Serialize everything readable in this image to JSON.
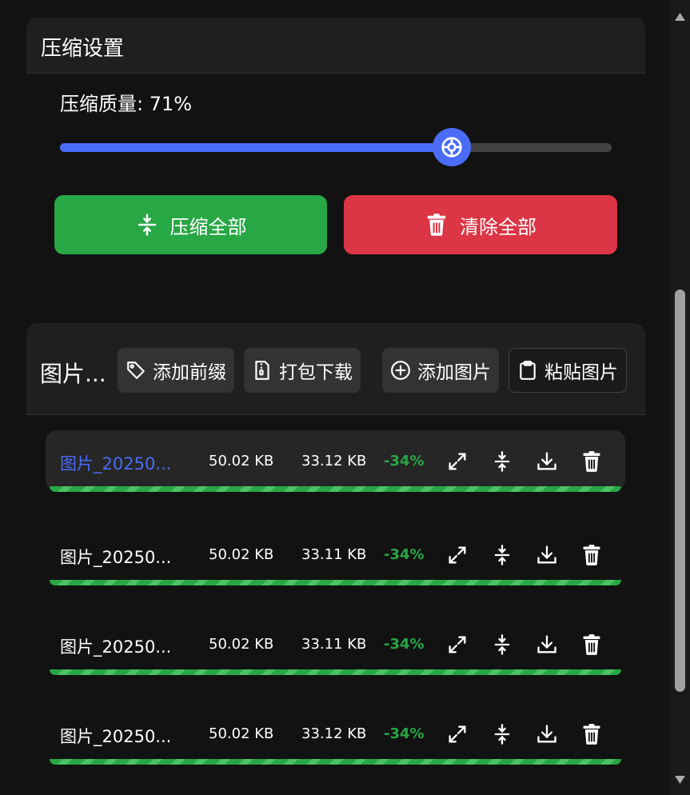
{
  "settings": {
    "title": "压缩设置",
    "quality_label": "压缩质量: 71%",
    "quality_value": 0.71,
    "accent_color": "#4a6cf7"
  },
  "actions": {
    "compress_all_label": "压缩全部",
    "clear_all_label": "清除全部",
    "compress_color": "#28a745",
    "clear_color": "#dc3545"
  },
  "image_list": {
    "title": "图片...",
    "tools": [
      {
        "label": "添加前缀",
        "icon": "tag-icon"
      },
      {
        "label": "打包下载",
        "icon": "zip-file-icon"
      },
      {
        "label": "添加图片",
        "icon": "plus-circle-icon"
      },
      {
        "label": "粘贴图片",
        "icon": "clipboard-icon"
      }
    ],
    "rows": [
      {
        "name": "图片_20250...",
        "original": "50.02 KB",
        "compressed": "33.12 KB",
        "change": "-34%",
        "progress": 1.0
      },
      {
        "name": "图片_20250...",
        "original": "50.02 KB",
        "compressed": "33.11 KB",
        "change": "-34%",
        "progress": 1.0
      },
      {
        "name": "图片_20250...",
        "original": "50.02 KB",
        "compressed": "33.11 KB",
        "change": "-34%",
        "progress": 1.0
      },
      {
        "name": "图片_20250...",
        "original": "50.02 KB",
        "compressed": "33.12 KB",
        "change": "-34%",
        "progress": 1.0
      }
    ],
    "row_icons": [
      "expand-icon",
      "compress-icon",
      "download-icon",
      "trash-icon"
    ],
    "percent_color": "#28a745"
  }
}
